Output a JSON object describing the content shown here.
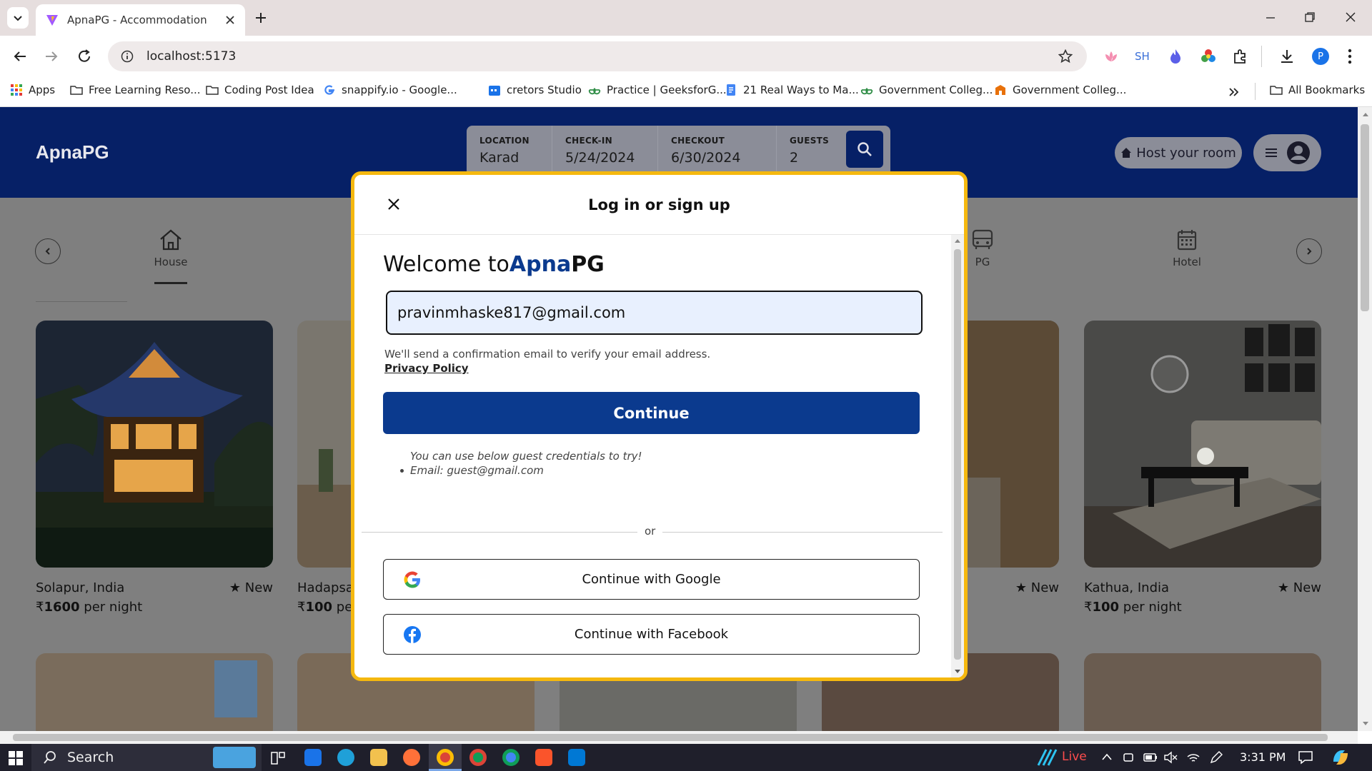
{
  "browser": {
    "tab_title": "ApnaPG - Accommodation Solu",
    "url": "localhost:5173",
    "profile_initial": "P",
    "ext_sh": "SH",
    "bookmarks": [
      {
        "label": "Apps"
      },
      {
        "label": "Free Learning Reso..."
      },
      {
        "label": "Coding Post Idea"
      },
      {
        "label": "snappify.io - Google..."
      },
      {
        "label": "cretors Studio"
      },
      {
        "label": "Practice | GeeksforG..."
      },
      {
        "label": "21 Real Ways to Ma..."
      },
      {
        "label": "Government Colleg..."
      },
      {
        "label": "Government Colleg..."
      }
    ],
    "all_bookmarks": "All Bookmarks"
  },
  "site": {
    "brand": "ApnaPG",
    "search": {
      "location_label": "LOCATION",
      "location_value": "Karad",
      "checkin_label": "CHECK-IN",
      "checkin_value": "5/24/2024",
      "checkout_label": "CHECKOUT",
      "checkout_value": "6/30/2024",
      "guests_label": "GUESTS",
      "guests_value": "2"
    },
    "host_button": "Host your room",
    "categories": [
      {
        "label": "House",
        "active": true
      },
      {
        "label": "PG"
      },
      {
        "label": "Hotel"
      }
    ],
    "listings": [
      {
        "location": "Solapur, India",
        "badge": "New",
        "price_symbol": "₹",
        "price": "1600",
        "unit": "per night"
      },
      {
        "location": "Hadapsa",
        "price_symbol": "₹",
        "price": "100",
        "unit": "pe"
      },
      {
        "badge": "New"
      },
      {
        "location": "Kathua, India",
        "badge": "New",
        "price_symbol": "₹",
        "price": "100",
        "unit": "per night"
      }
    ]
  },
  "modal": {
    "title": "Log in or sign up",
    "welcome_prefix": "Welcome to",
    "welcome_brand_a": "Apna",
    "welcome_brand_b": "PG",
    "email_value": "pravinmhaske817@gmail.com",
    "note": "We'll send a confirmation email to verify your email address.",
    "privacy": "Privacy Policy",
    "continue": "Continue",
    "guest_note": "You can use below guest credentials to try!",
    "guest_email": "Email: guest@gmail.com",
    "or": "or",
    "google": "Continue with Google",
    "facebook": "Continue with Facebook"
  },
  "taskbar": {
    "search": "Search",
    "live": "Live",
    "time": "3:31 PM"
  },
  "colors": {
    "navy": "#062066",
    "accent": "#0b3a8e",
    "modal_border": "#f5b80f"
  }
}
